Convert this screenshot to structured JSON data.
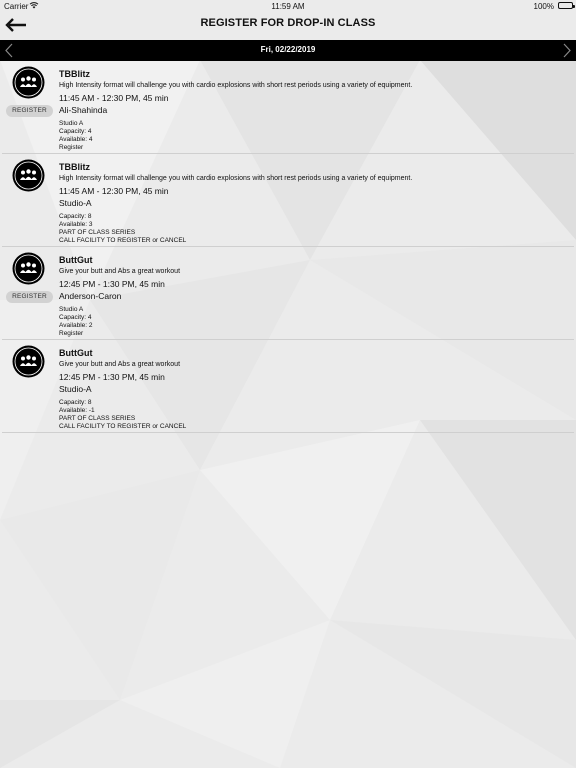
{
  "status_bar": {
    "carrier": "Carrier",
    "time": "11:59 AM",
    "battery": "100%"
  },
  "header": {
    "title": "REGISTER FOR DROP-IN CLASS"
  },
  "date_bar": {
    "date": "Fri, 02/22/2019"
  },
  "classes": [
    {
      "name": "TBBlitz",
      "description": "High Intensity format will challenge you with cardio explosions with short rest periods using a variety of equipment.",
      "time": "11:45 AM - 12:30 PM, 45 min",
      "place": "Ali-Shahinda",
      "details": [
        "Studio A",
        "Capacity: 4",
        "Available: 4",
        "Register"
      ],
      "register_label": "REGISTER"
    },
    {
      "name": "TBBlitz",
      "description": "High Intensity format will challenge you with cardio explosions with short rest periods using a variety of equipment.",
      "time": "11:45 AM - 12:30 PM, 45 min",
      "place": "Studio-A",
      "details": [
        "Capacity: 8",
        "Available: 3",
        "PART OF CLASS SERIES",
        "CALL FACILITY TO REGISTER or CANCEL"
      ]
    },
    {
      "name": "ButtGut",
      "description": "Give your butt and Abs a great workout",
      "time": "12:45 PM - 1:30 PM, 45 min",
      "place": "Anderson-Caron",
      "details": [
        "Studio A",
        "Capacity: 4",
        "Available: 2",
        "Register"
      ],
      "register_label": "REGISTER"
    },
    {
      "name": "ButtGut",
      "description": "Give your butt and Abs a great workout",
      "time": "12:45 PM - 1:30 PM, 45 min",
      "place": "Studio-A",
      "details": [
        "Capacity: 8",
        "Available: -1",
        "PART OF CLASS SERIES",
        "CALL FACILITY TO REGISTER or CANCEL"
      ]
    }
  ],
  "icons": {
    "back": "arrow-left-icon",
    "prev": "chevron-left-icon",
    "next": "chevron-right-icon",
    "class": "group-class-icon",
    "wifi": "wifi-icon",
    "battery": "battery-icon"
  },
  "colors": {
    "date_bar_bg": "#000000",
    "register_button_bg": "#d2d2d2",
    "icon_circle": "#000000"
  }
}
